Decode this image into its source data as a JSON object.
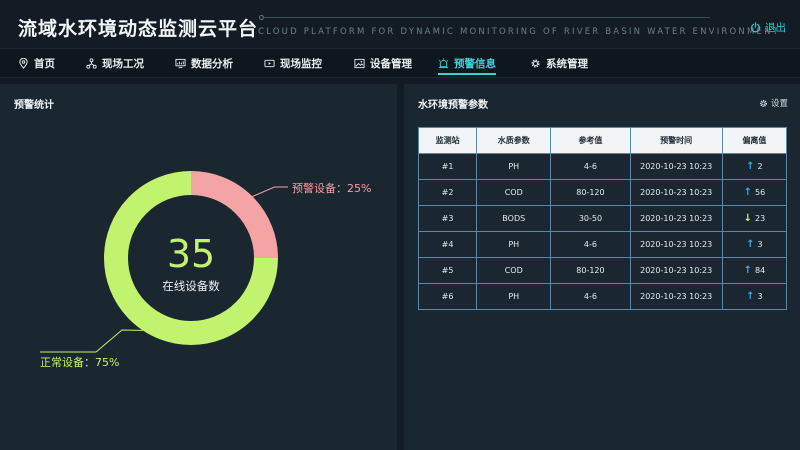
{
  "header": {
    "title": "流域水环境动态监测云平台",
    "subtitle": "CLOUD PLATFORM FOR DYNAMIC MONITORING OF RIVER BASIN WATER ENVIRONMENT",
    "logout_label": "退出"
  },
  "nav": {
    "items": [
      {
        "label": "首页",
        "icon": "location-pin-icon"
      },
      {
        "label": "现场工况",
        "icon": "network-icon"
      },
      {
        "label": "数据分析",
        "icon": "monitor-chart-icon"
      },
      {
        "label": "现场监控",
        "icon": "video-icon"
      },
      {
        "label": "设备管理",
        "icon": "image-icon"
      },
      {
        "label": "预警信息",
        "icon": "alarm-icon",
        "active": true
      },
      {
        "label": "系统管理",
        "icon": "gear-icon"
      }
    ]
  },
  "left_panel": {
    "title": "预警统计",
    "center_value": "35",
    "center_label": "在线设备数",
    "warning_label": "预警设备：25%",
    "normal_label": "正常设备：75%"
  },
  "chart_data": {
    "type": "pie",
    "categories": [
      "预警设备",
      "正常设备"
    ],
    "values": [
      25,
      75
    ],
    "colors": [
      "#f4a4a4",
      "#c2f36e"
    ]
  },
  "right_panel": {
    "title": "水环境预警参数",
    "settings_label": "设置",
    "table": {
      "headers": [
        "监测站",
        "水质参数",
        "参考值",
        "预警时间",
        "偏离值"
      ],
      "rows": [
        {
          "station": "#1",
          "param": "PH",
          "ref": "4-6",
          "time": "2020-10-23  10:23",
          "dev": "2",
          "dir": "up"
        },
        {
          "station": "#2",
          "param": "COD",
          "ref": "80-120",
          "time": "2020-10-23  10:23",
          "dev": "56",
          "dir": "up"
        },
        {
          "station": "#3",
          "param": "BODS",
          "ref": "30-50",
          "time": "2020-10-23  10:23",
          "dev": "23",
          "dir": "down"
        },
        {
          "station": "#4",
          "param": "PH",
          "ref": "4-6",
          "time": "2020-10-23  10:23",
          "dev": "3",
          "dir": "up"
        },
        {
          "station": "#5",
          "param": "COD",
          "ref": "80-120",
          "time": "2020-10-23  10:23",
          "dev": "84",
          "dir": "up"
        },
        {
          "station": "#6",
          "param": "PH",
          "ref": "4-6",
          "time": "2020-10-23  10:23",
          "dev": "3",
          "dir": "up"
        }
      ]
    }
  }
}
